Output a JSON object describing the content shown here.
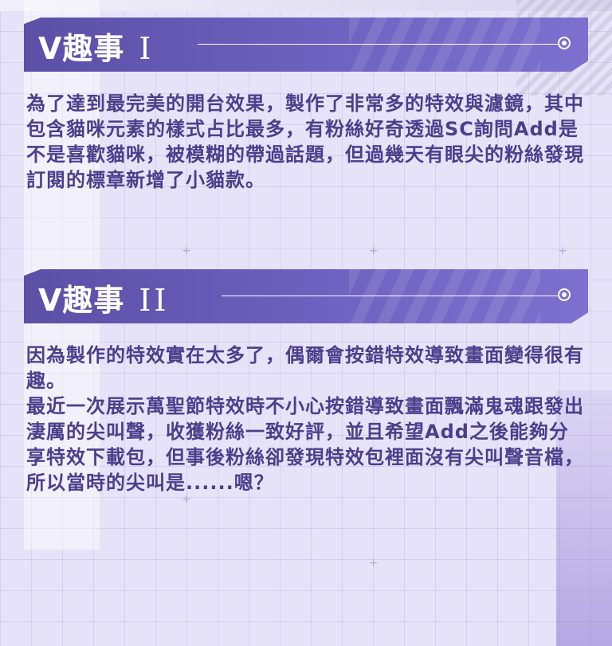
{
  "sections": [
    {
      "title_prefix": "V趣事",
      "title_numeral": "I",
      "paragraphs": [
        "為了達到最完美的開台效果，製作了非常多的特效與濾鏡，其中包含貓咪元素的樣式占比最多，有粉絲好奇透過SC詢問Add是不是喜歡貓咪，被模糊的帶過話題，但過幾天有眼尖的粉絲發現訂閱的標章新增了小貓款。"
      ]
    },
    {
      "title_prefix": "V趣事",
      "title_numeral": "II",
      "paragraphs": [
        "因為製作的特效實在太多了，偶爾會按錯特效導致畫面變得很有趣。",
        "最近一次展示萬聖節特效時不小心按錯導致畫面飄滿鬼魂跟發出淒厲的尖叫聲，收獲粉絲一致好評，並且希望Add之後能夠分享特效下載包，但事後粉絲卻發現特效包裡面沒有尖叫聲音檔，所以當時的尖叫是......嗯？"
      ]
    }
  ],
  "colors": {
    "header_start": "#5b4fa6",
    "header_end": "#7d70cf",
    "text": "#4b3f8c",
    "background": "#e6e3f8"
  },
  "icons": [
    "target-dot-icon"
  ]
}
